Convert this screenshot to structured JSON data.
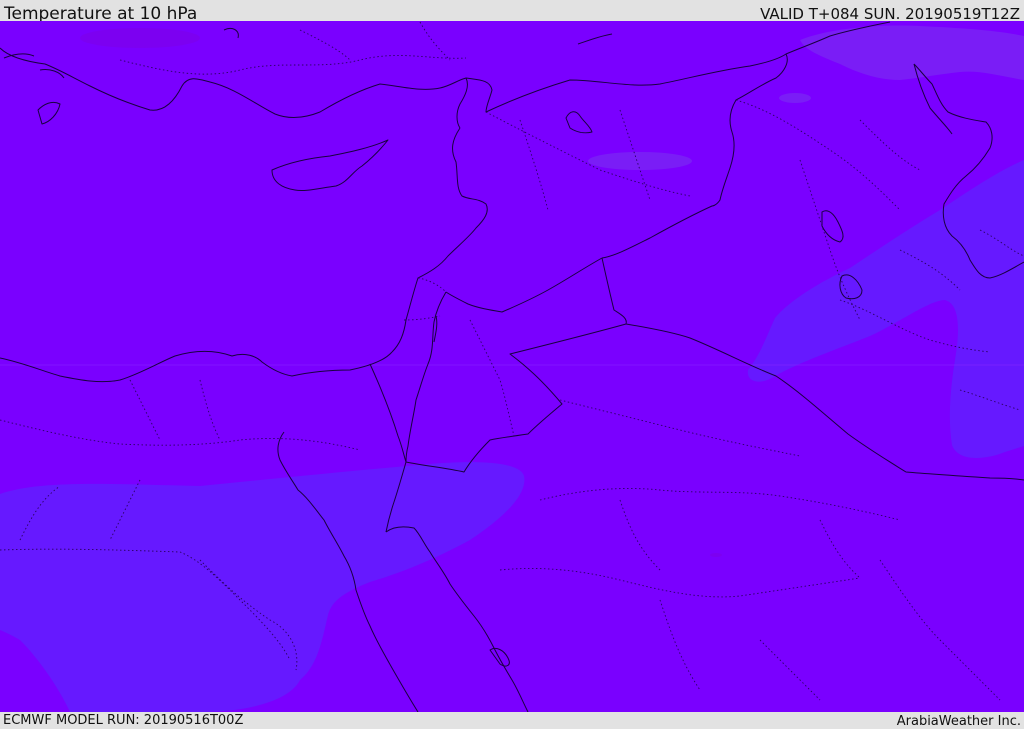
{
  "header": {
    "title": "Temperature at 10 hPa",
    "valid_time": "VALID T+084 SUN. 20190519T12Z"
  },
  "footer": {
    "model_run": "ECMWF MODEL RUN: 20190516T00Z",
    "credit": "ArabiaWeather Inc."
  },
  "map": {
    "fill_colors": {
      "base": "#7a00ff",
      "cool_region": "#6619ff",
      "cool_patch": "#7a22f5",
      "warm_spot": "#7d00e8"
    },
    "line_colors": {
      "coastline": "#1a0040",
      "border": "#1a0040"
    }
  }
}
